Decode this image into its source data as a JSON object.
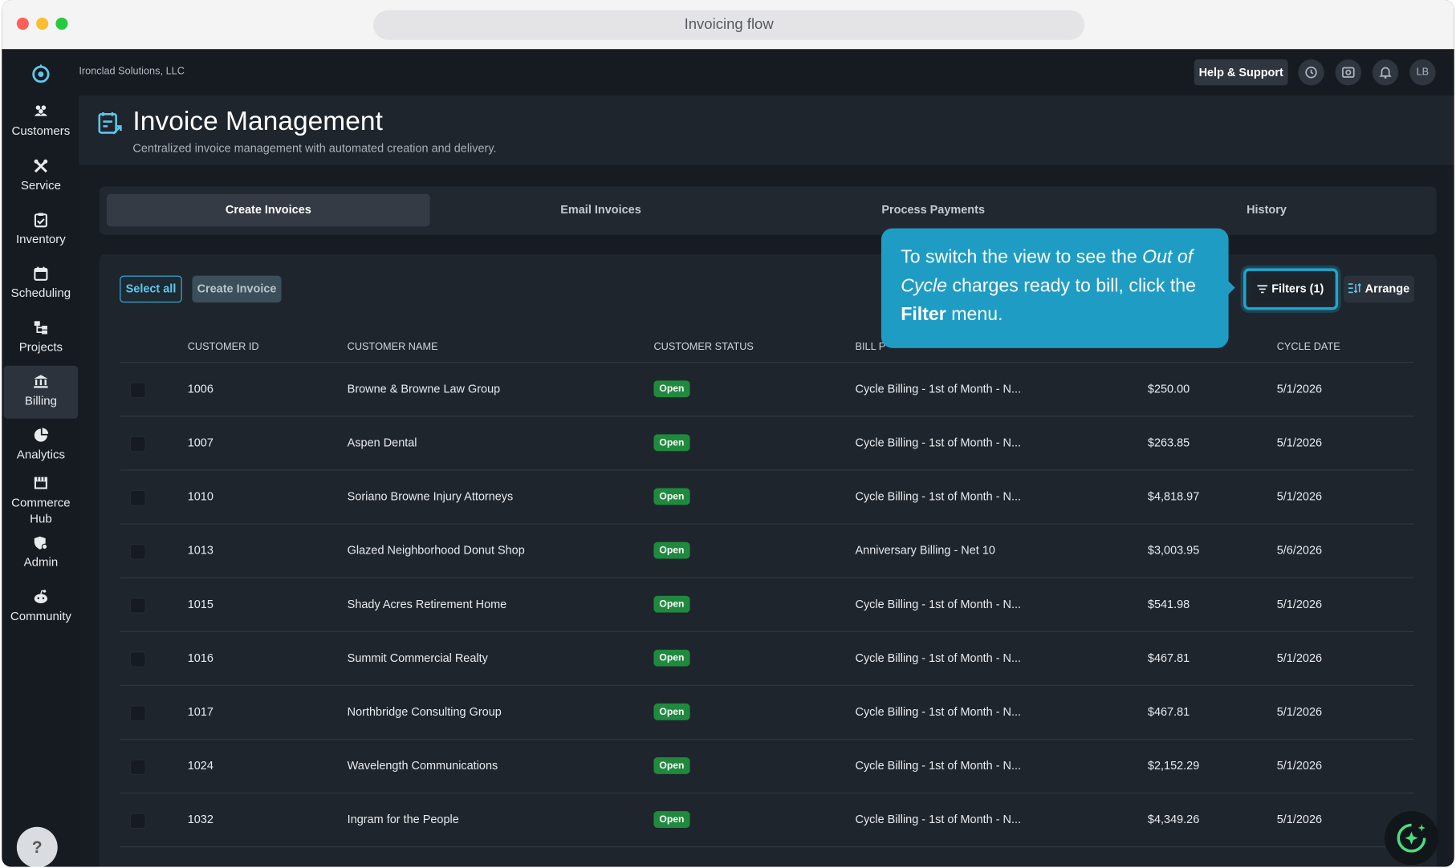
{
  "browser": {
    "title": "Invoicing flow"
  },
  "org": {
    "name": "Ironclad Solutions, LLC"
  },
  "topbar": {
    "help_label": "Help & Support",
    "avatar_initials": "LB"
  },
  "sidebar": {
    "items": [
      {
        "label": "Customers",
        "icon": "customers-icon"
      },
      {
        "label": "Service",
        "icon": "service-icon"
      },
      {
        "label": "Inventory",
        "icon": "inventory-icon"
      },
      {
        "label": "Scheduling",
        "icon": "calendar-icon"
      },
      {
        "label": "Projects",
        "icon": "projects-icon"
      },
      {
        "label": "Billing",
        "icon": "bank-icon"
      },
      {
        "label": "Analytics",
        "icon": "pie-chart-icon"
      },
      {
        "label": "Commerce Hub",
        "icon": "store-icon"
      },
      {
        "label": "Admin",
        "icon": "admin-gear-icon"
      },
      {
        "label": "Community",
        "icon": "community-icon"
      }
    ],
    "active": "Billing",
    "help_label": "?"
  },
  "header": {
    "title": "Invoice Management",
    "subtitle": "Centralized invoice management with automated creation and delivery."
  },
  "tabs": [
    {
      "label": "Create Invoices",
      "active": true
    },
    {
      "label": "Email Invoices",
      "active": false
    },
    {
      "label": "Process Payments",
      "active": false
    },
    {
      "label": "History",
      "active": false
    }
  ],
  "toolbar": {
    "select_all": "Select all",
    "create_invoice": "Create Invoice",
    "filters": "Filters (1)",
    "arrange": "Arrange"
  },
  "table": {
    "columns": [
      "CUSTOMER ID",
      "CUSTOMER NAME",
      "CUSTOMER STATUS",
      "BILL P",
      "CYCLE DATE"
    ],
    "rows": [
      {
        "id": "1006",
        "name": "Browne & Browne Law Group",
        "status": "Open",
        "bill_plan": "Cycle Billing - 1st of Month - N...",
        "amount": "$250.00",
        "cycle_date": "5/1/2026"
      },
      {
        "id": "1007",
        "name": "Aspen Dental",
        "status": "Open",
        "bill_plan": "Cycle Billing - 1st of Month - N...",
        "amount": "$263.85",
        "cycle_date": "5/1/2026"
      },
      {
        "id": "1010",
        "name": "Soriano Browne Injury Attorneys",
        "status": "Open",
        "bill_plan": "Cycle Billing - 1st of Month - N...",
        "amount": "$4,818.97",
        "cycle_date": "5/1/2026"
      },
      {
        "id": "1013",
        "name": "Glazed Neighborhood Donut Shop",
        "status": "Open",
        "bill_plan": "Anniversary Billing - Net 10",
        "amount": "$3,003.95",
        "cycle_date": "5/6/2026"
      },
      {
        "id": "1015",
        "name": "Shady Acres Retirement Home",
        "status": "Open",
        "bill_plan": "Cycle Billing - 1st of Month - N...",
        "amount": "$541.98",
        "cycle_date": "5/1/2026"
      },
      {
        "id": "1016",
        "name": "Summit Commercial Realty",
        "status": "Open",
        "bill_plan": "Cycle Billing - 1st of Month - N...",
        "amount": "$467.81",
        "cycle_date": "5/1/2026"
      },
      {
        "id": "1017",
        "name": "Northbridge Consulting Group",
        "status": "Open",
        "bill_plan": "Cycle Billing - 1st of Month - N...",
        "amount": "$467.81",
        "cycle_date": "5/1/2026"
      },
      {
        "id": "1024",
        "name": "Wavelength Communications",
        "status": "Open",
        "bill_plan": "Cycle Billing - 1st of Month - N...",
        "amount": "$2,152.29",
        "cycle_date": "5/1/2026"
      },
      {
        "id": "1032",
        "name": "Ingram for the People",
        "status": "Open",
        "bill_plan": "Cycle Billing - 1st of Month - N...",
        "amount": "$4,349.26",
        "cycle_date": "5/1/2026"
      }
    ]
  },
  "tooltip": {
    "part1": "To switch the view to see the ",
    "emph": "Out of Cycle",
    "part2": " charges ready to bill, click the ",
    "strong": "Filter",
    "part3": " menu."
  },
  "colors": {
    "accent": "#1e9cc4",
    "badge_open": "#1f8a3e",
    "background": "#1b2129"
  }
}
